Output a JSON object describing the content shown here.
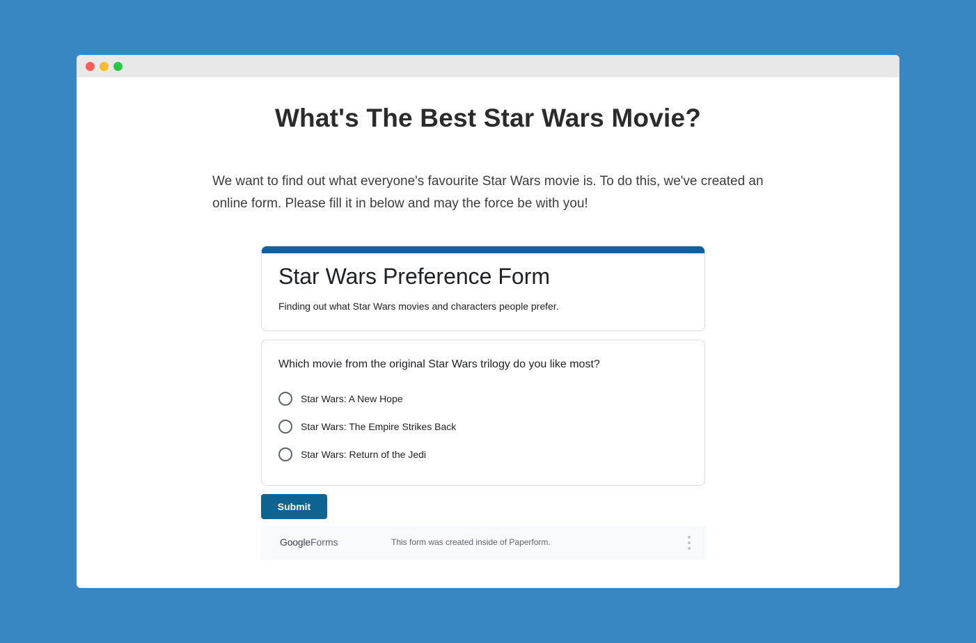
{
  "page": {
    "title": "What's The Best Star Wars Movie?",
    "intro": "We want to find out what everyone's favourite Star Wars movie is. To do this, we've created an online form. Please fill it in below and may the force be with you!"
  },
  "form": {
    "title": "Star Wars Preference Form",
    "description": "Finding out what Star Wars movies and characters people prefer.",
    "question": "Which movie from the original Star Wars trilogy do you like most?",
    "options": [
      "Star Wars: A New Hope",
      "Star Wars: The Empire Strikes Back",
      "Star Wars: Return of the Jedi"
    ],
    "submit_label": "Submit"
  },
  "footer": {
    "brand_google": "Google",
    "brand_forms": "Forms",
    "note": "This form was created inside of Paperform."
  },
  "icons": {
    "more": "more-vert-icon",
    "window_controls": [
      "close-dot",
      "minimize-dot",
      "maximize-dot"
    ]
  },
  "colors": {
    "background": "#3887c3",
    "accent": "#0e6491"
  }
}
